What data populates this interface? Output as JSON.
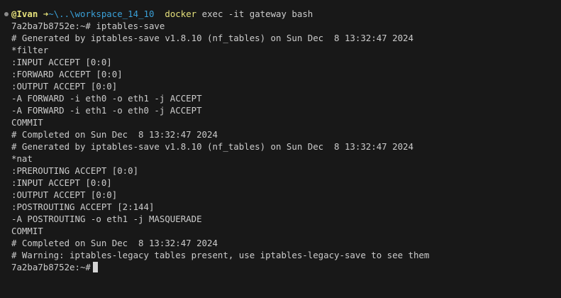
{
  "prompt": {
    "user": "@Ivan",
    "arrow": "➜",
    "path": "~\\..\\workspace_14_10",
    "command": "docker",
    "args": "exec -it gateway bash"
  },
  "output_lines": [
    "7a2ba7b8752e:~# iptables-save",
    "# Generated by iptables-save v1.8.10 (nf_tables) on Sun Dec  8 13:32:47 2024",
    "*filter",
    ":INPUT ACCEPT [0:0]",
    ":FORWARD ACCEPT [0:0]",
    ":OUTPUT ACCEPT [0:0]",
    "-A FORWARD -i eth0 -o eth1 -j ACCEPT",
    "-A FORWARD -i eth1 -o eth0 -j ACCEPT",
    "COMMIT",
    "# Completed on Sun Dec  8 13:32:47 2024",
    "# Generated by iptables-save v1.8.10 (nf_tables) on Sun Dec  8 13:32:47 2024",
    "*nat",
    ":PREROUTING ACCEPT [0:0]",
    ":INPUT ACCEPT [0:0]",
    ":OUTPUT ACCEPT [0:0]",
    ":POSTROUTING ACCEPT [2:144]",
    "-A POSTROUTING -o eth1 -j MASQUERADE",
    "COMMIT",
    "# Completed on Sun Dec  8 13:32:47 2024",
    "# Warning: iptables-legacy tables present, use iptables-legacy-save to see them"
  ],
  "final_prompt": "7a2ba7b8752e:~#",
  "colors": {
    "background": "#181818",
    "text": "#cccccc",
    "user": "#e5e07b",
    "path": "#3aa0d8",
    "cursor": "#d4d4d4"
  }
}
